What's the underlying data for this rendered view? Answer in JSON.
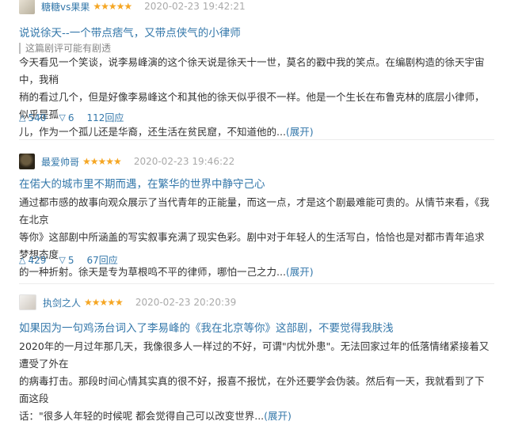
{
  "reviews": [
    {
      "author": "糖糖vs果果",
      "stars": "★★★★★",
      "time": "2020-02-23 19:42:21",
      "title": "说说徐天--一个带点痞气，又带点侠气的小律师",
      "spoiler_notice": "这篇剧评可能有剧透",
      "body_lines": [
        "今天看见一个笑谈，说李易峰演的这个徐天说是徐天十一世，莫名的戳中我的笑点。在编剧构造的徐天宇宙中，我稍",
        "稍的看过几个，但是好像李易峰这个和其他的徐天似乎很不一样。他是一个生长在布鲁克林的底层小律师，似乎是孤",
        "儿，作为一个孤儿还是华裔，还生活在贫民窟，不知道他的..."
      ],
      "expand": "(展开)",
      "useful": "540",
      "useless": "6",
      "replies": "112回应"
    },
    {
      "author": "最爱帅哥",
      "stars": "★★★★★",
      "time": "2020-02-23 19:46:22",
      "title": "在偌大的城市里不期而遇，在繁华的世界中静守己心",
      "body_lines": [
        "通过都市感的故事向观众展示了当代青年的正能量，而这一点，才是这个剧最难能可贵的。从情节来看，《我在北京",
        "等你》这部剧中所涵盖的写实叙事充满了现实色彩。剧中对于年轻人的生活写白，恰恰也是对都市青年追求梦想态度",
        "的一种折射。徐天是专为草根鸣不平的律师，哪怕一己之力..."
      ],
      "expand": "(展开)",
      "useful": "429",
      "useless": "5",
      "replies": "67回应"
    },
    {
      "author": "执剑之人",
      "stars": "★★★★★",
      "time": "2020-02-23 20:20:39",
      "title": "如果因为一句鸡汤台词入了李易峰的《我在北京等你》这部剧，不要觉得我肤浅",
      "body_lines": [
        "2020年的一月过年那几天，我像很多人一样过的不好，可谓\"内忧外患\"。无法回家过年的低落情绪紧接着又遭受了外在",
        "的病毒打击。那段时间心情其实真的很不好，报喜不报忧，在外还要学会伪装。然后有一天，我就看到了下面这段",
        "话：\"很多人年轻的时候呢 都会觉得自己可以改变世界..."
      ],
      "expand": "(展开)"
    }
  ],
  "icons": {
    "useful": "thumbs-up-triangle-icon",
    "useless": "thumbs-down-triangle-icon"
  },
  "colors": {
    "link": "#3377aa",
    "star": "#f5a623",
    "time": "#aaaaaa"
  }
}
